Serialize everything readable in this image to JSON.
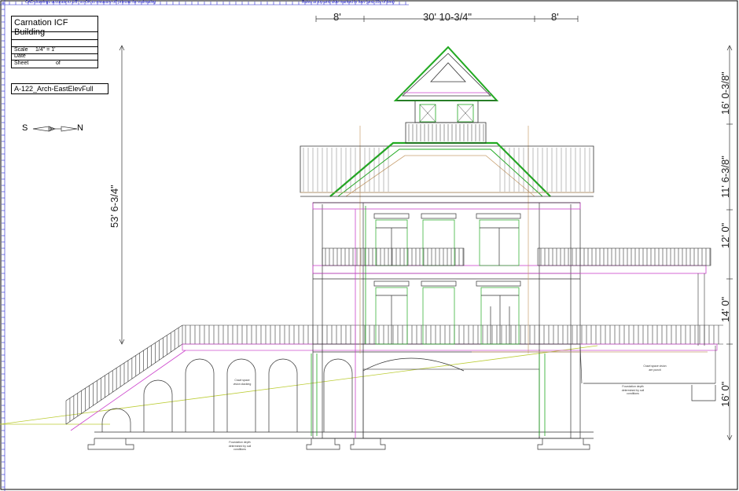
{
  "ruler_notes": {
    "left": "CAD drawings accurate to 1/8\" so OK to measure off printout for estimating",
    "center": "Rules at top and side marked in feet (and 10s of feet)"
  },
  "title_block": {
    "title": "Carnation ICF Building",
    "scale_label": "Scale",
    "scale_value": "1/4\" = 1'",
    "date_label": "Date",
    "sheet_label": "Sheet",
    "sheet_of": "of"
  },
  "sheet_id": "A-122_Arch-EastElevFull",
  "compass": {
    "south": "S",
    "north": "N"
  },
  "dimensions": {
    "top_left": "8'",
    "top_center": "30' 10-3/4\"",
    "top_right": "8'",
    "overall_height": "53' 6-3/4\"",
    "right_1": "16' 0-3/8\"",
    "right_2": "11' 6-3/8\"",
    "right_3": "12' 0\"",
    "right_4": "14' 0\"",
    "right_5": "16' 0\""
  },
  "notes": {
    "crawl_left": "Crawl space vision clacking",
    "foundation_center": "Foundation depth determined by soil conditions",
    "crawl_right": "Crawl space vision are puncti",
    "foundation_right": "Foundation depth determined by soil conditions"
  },
  "colors": {
    "green": "#22aa22",
    "magenta": "#cc44cc",
    "tan": "#c8a070",
    "yellow_green": "#bbcc33",
    "blue_ruler": "#2222cc",
    "line": "#333333"
  }
}
